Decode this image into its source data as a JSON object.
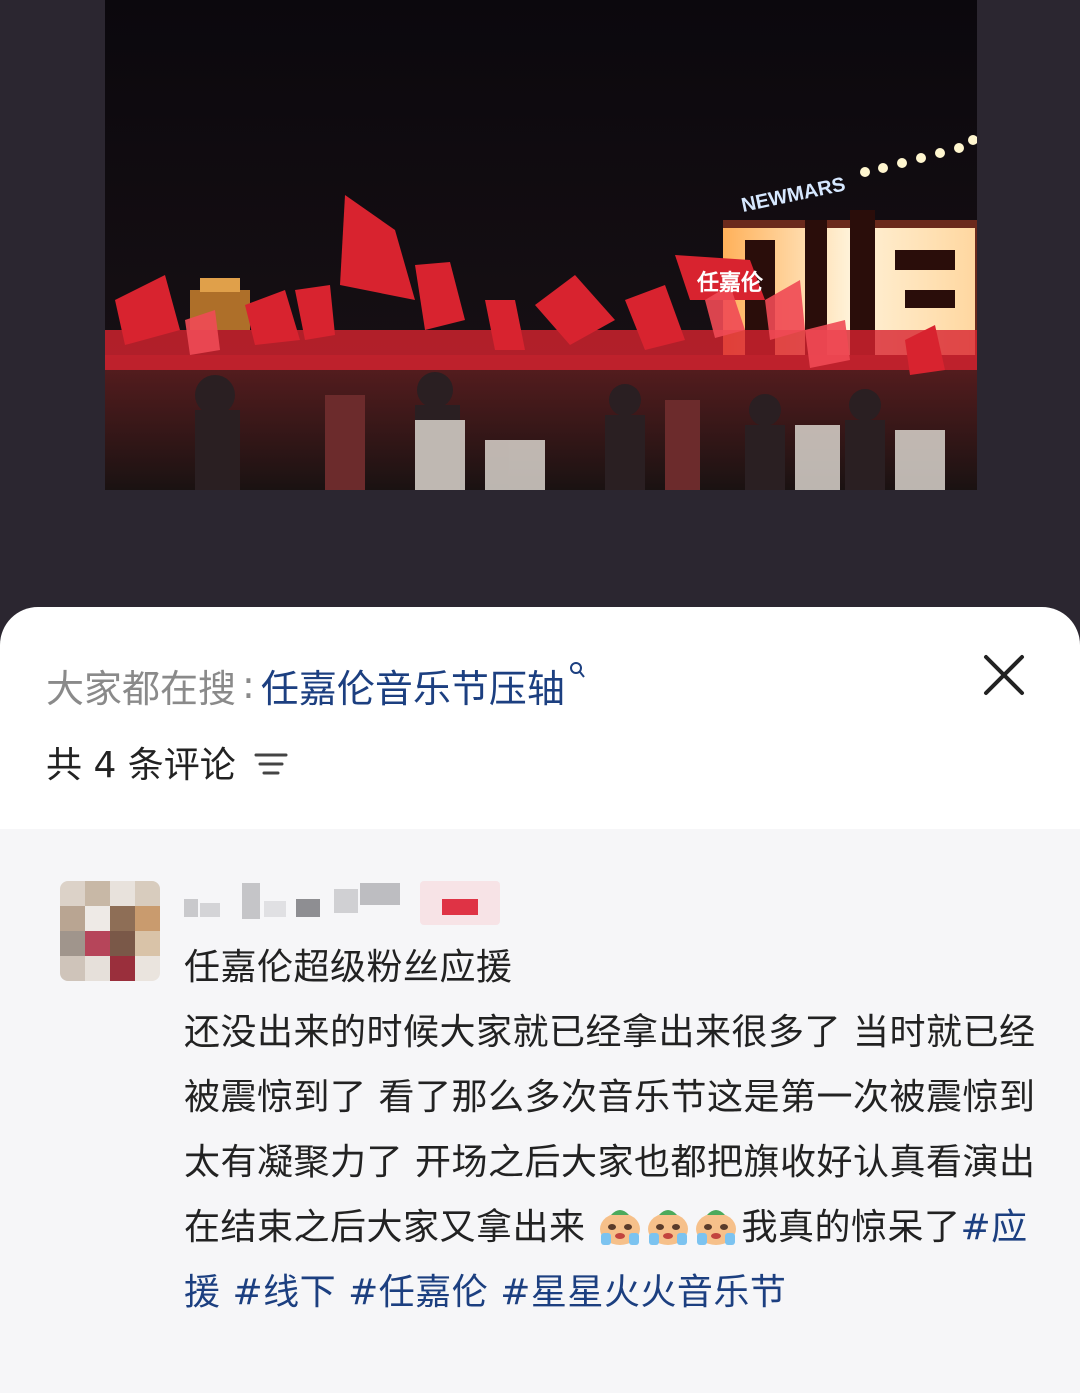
{
  "search": {
    "prefix": "大家都在搜",
    "separator": ":",
    "term": "任嘉伦音乐节压轴",
    "suffix_icon": "search-small-icon"
  },
  "header": {
    "comment_count_label": "共 4 条评论",
    "close_icon": "close-icon",
    "sort_icon": "sort-filter-icon"
  },
  "photo": {
    "sign_text": "NEWMARS",
    "flag_text": "任嘉伦"
  },
  "comment": {
    "title": "任嘉伦超级粉丝应援",
    "body": "还没出来的时候大家就已经拿出来很多了 当时就已经被震惊到了 看了那么多次音乐节这是第一次被震惊到 太有凝聚力了 开场之后大家也都把旗收好认真看演出 在结束之后大家又拿出来",
    "emoji_icon": "crying-face-emoji",
    "emoji_count": 3,
    "tail": "我真的惊呆了",
    "hashtags": [
      "#应援",
      "#线下",
      "#任嘉伦",
      "#星星火火音乐节"
    ]
  },
  "colors": {
    "link": "#1c3f80",
    "muted": "#8a8a8a",
    "text": "#222222",
    "sheet_bg": "#ffffff",
    "comment_bg": "#f6f6f8",
    "backdrop": "#2b2630",
    "flag_red": "#d8232f"
  }
}
